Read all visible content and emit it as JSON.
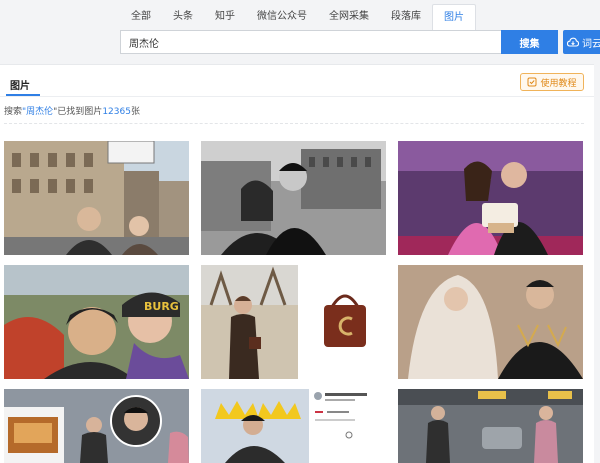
{
  "tabs": [
    {
      "label": "全部",
      "active": false
    },
    {
      "label": "头条",
      "active": false
    },
    {
      "label": "知乎",
      "active": false
    },
    {
      "label": "微信公众号",
      "active": false
    },
    {
      "label": "全网采集",
      "active": false
    },
    {
      "label": "段落库",
      "active": false
    },
    {
      "label": "图片",
      "active": true
    }
  ],
  "search": {
    "value": "周杰伦",
    "button_label": "搜集",
    "wordcloud_label": "词云生"
  },
  "panel": {
    "title": "图片",
    "guide_label": "使用教程",
    "result_prefix": "搜索",
    "result_quote_open": "\"",
    "result_keyword": "周杰伦",
    "result_middle": "\"已找到图片",
    "result_count": "12365",
    "result_suffix": "张"
  },
  "thumbs": {
    "cake_sign": "BURG"
  },
  "colors": {
    "accent": "#2f7fe5",
    "guide": "#e08a1a"
  }
}
